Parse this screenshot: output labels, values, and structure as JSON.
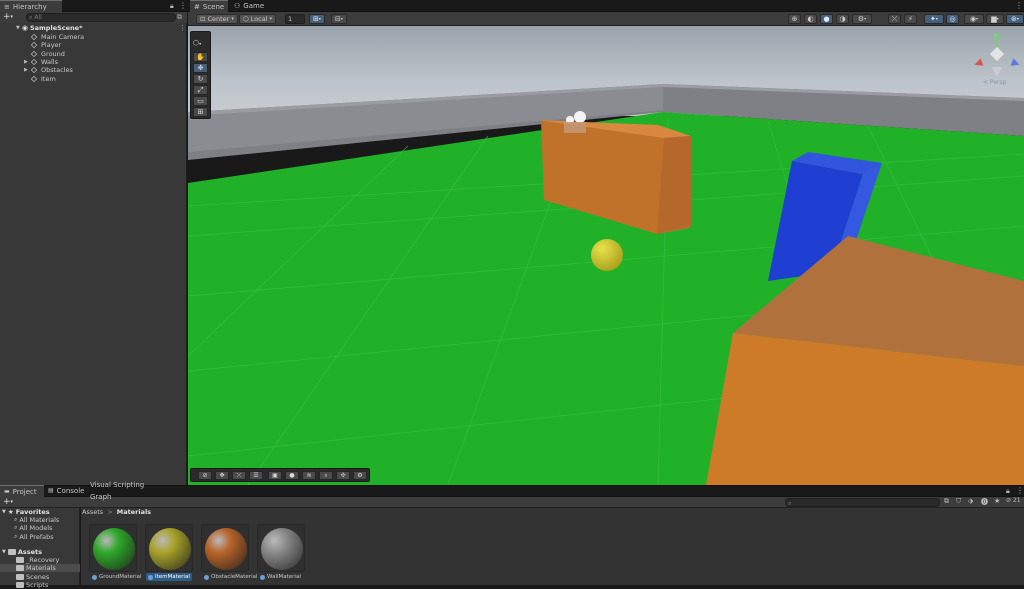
{
  "hierarchy": {
    "tab_label": "Hierarchy",
    "add_label": "+",
    "search_placeholder": "All",
    "scene_name": "SampleScene*",
    "items": [
      {
        "label": "Main Camera",
        "has_children": false
      },
      {
        "label": "Player",
        "has_children": false
      },
      {
        "label": "Ground",
        "has_children": false
      },
      {
        "label": "Walls",
        "has_children": true
      },
      {
        "label": "Obstacles",
        "has_children": true
      },
      {
        "label": "Item",
        "has_children": false
      }
    ]
  },
  "scene_view": {
    "tabs": [
      {
        "label": "Scene",
        "icon": "grid-icon",
        "active": true
      },
      {
        "label": "Game",
        "icon": "gamepad-icon",
        "active": false
      }
    ],
    "pivot_mode": "Center",
    "pivot_rotation": "Local",
    "grid_snap_value": "1",
    "projection_label": "< Persp",
    "gizmo_axes": {
      "x": "x",
      "y": "y",
      "z": "z"
    }
  },
  "project": {
    "tabs": [
      {
        "label": "Project",
        "icon": "folder-icon",
        "active": true
      },
      {
        "label": "Console",
        "icon": "console-icon",
        "active": false
      },
      {
        "label": "Visual Scripting Graph",
        "icon": "",
        "active": false
      }
    ],
    "favorites_label": "Favorites",
    "favorites": [
      "All Materials",
      "All Models",
      "All Prefabs"
    ],
    "assets_label": "Assets",
    "assets_folders": [
      "_Recovery",
      "Materials",
      "Scenes",
      "Scripts"
    ],
    "selected_folder": "Materials",
    "breadcrumb": {
      "root": "Assets",
      "separator": ">",
      "current": "Materials"
    },
    "hidden_count": "21",
    "materials": [
      {
        "name": "GroundMaterial",
        "color": "#2fa82a",
        "selected": false
      },
      {
        "name": "ItemMaterial",
        "color": "#a8a22a",
        "selected": true
      },
      {
        "name": "ObstacleMaterial",
        "color": "#b8642a",
        "selected": false
      },
      {
        "name": "WallMaterial",
        "color": "#8a8a8a",
        "selected": false
      }
    ]
  },
  "colors": {
    "ground": "#21b32a",
    "obstacle": "#d07a2a",
    "wall_block": "#1d3fd0",
    "item": "#d6cf2e",
    "sky": "#b4bcc4",
    "selection_blue": "#2c5d87"
  }
}
